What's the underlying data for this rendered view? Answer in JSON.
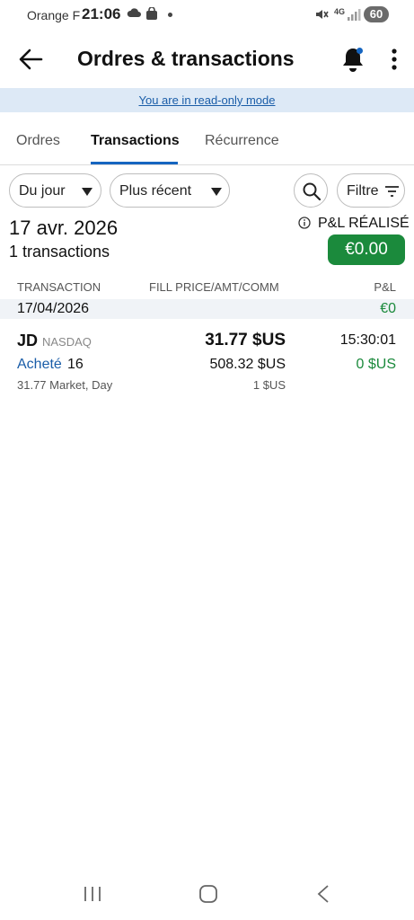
{
  "status_bar": {
    "carrier": "Orange F",
    "time": "21:06",
    "network": "4G",
    "battery": "60"
  },
  "app_bar": {
    "title": "Ordres & transactions"
  },
  "banner": {
    "text": "You are in read-only mode"
  },
  "tabs": [
    {
      "label": "Ordres"
    },
    {
      "label": "Transactions"
    },
    {
      "label": "Récurrence"
    }
  ],
  "filters": {
    "period": "Du jour",
    "sort": "Plus récent",
    "filter_label": "Filtre"
  },
  "summary": {
    "date": "17 avr. 2026",
    "count": "1 transactions",
    "pl_label": "P&L RÉALISÉ",
    "pl_value": "€0.00"
  },
  "table": {
    "headers": [
      "TRANSACTION",
      "FILL PRICE/AMT/COMM",
      "P&L"
    ],
    "groups": [
      {
        "date": "17/04/2026",
        "pl": "€0",
        "rows": [
          {
            "symbol": "JD",
            "exchange": "NASDAQ",
            "price": "31.77 $US",
            "time": "15:30:01",
            "side": "Acheté",
            "quantity": "16",
            "amount": "508.32 $US",
            "pl": "0 $US",
            "description": "31.77 Market, Day",
            "commission": "1 $US"
          }
        ]
      }
    ]
  },
  "colors": {
    "accent": "#1565c0",
    "positive": "#1b8a3c",
    "banner_bg": "#dde9f6"
  }
}
